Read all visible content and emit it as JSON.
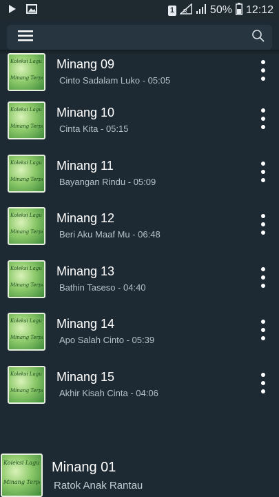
{
  "status_bar": {
    "battery_percent": "50%",
    "time": "12:12",
    "sim_label": "1",
    "network_label": "R"
  },
  "app_bar": {
    "menu_icon": "hamburger-menu-icon",
    "search_icon": "search-icon"
  },
  "songs": [
    {
      "title": "Minang 09",
      "artist": "Cinto Sadalam Luko",
      "duration": "05:05"
    },
    {
      "title": "Minang 10",
      "artist": "Cinta Kita",
      "duration": "05:15"
    },
    {
      "title": "Minang 11",
      "artist": "Bayangan Rindu",
      "duration": "05:09"
    },
    {
      "title": "Minang 12",
      "artist": "Beri Aku Maaf Mu",
      "duration": "06:48"
    },
    {
      "title": "Minang 13",
      "artist": "Bathin Taseso",
      "duration": "04:40"
    },
    {
      "title": "Minang 14",
      "artist": "Apo Salah Cinto",
      "duration": "05:39"
    },
    {
      "title": "Minang 15",
      "artist": "Akhir Kisah Cinta",
      "duration": "04:06"
    }
  ],
  "album_art_text": [
    "Koleksi Lagu",
    "Minang Terpopuler"
  ],
  "now_playing": {
    "title": "Minang 01",
    "subtitle": "Ratok Anak Rantau"
  },
  "colors": {
    "background": "#1e2a33",
    "app_bar": "#263540",
    "subtitle": "#b6c2c9"
  }
}
